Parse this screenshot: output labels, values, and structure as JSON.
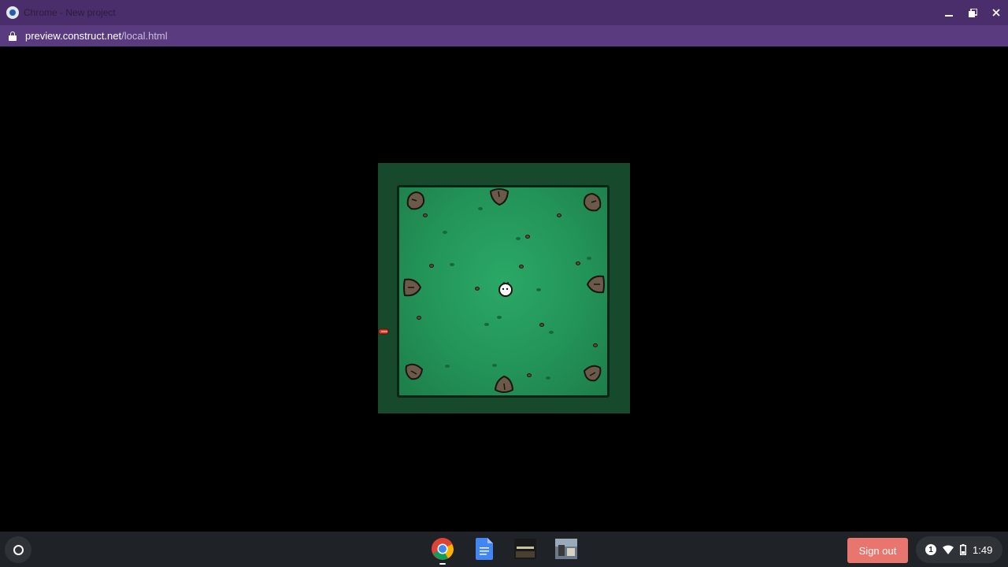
{
  "window": {
    "title": "Chrome - New project",
    "url_host": "preview.construct.net",
    "url_path": "/local.html",
    "controls": {
      "minimize_icon": "minimize-icon",
      "maximize_icon": "restore-icon",
      "close_icon": "close-icon"
    }
  },
  "game": {
    "name": "construct-game-canvas",
    "colors": {
      "floor": "#239458",
      "border": "#174a2d",
      "enemy": "#6b5a4a",
      "player": "#ffffff",
      "arrow": "#d8402a"
    }
  },
  "shelf": {
    "launcher_icon": "launcher-icon",
    "apps": [
      {
        "name": "chrome",
        "icon": "chrome-icon",
        "running": true
      },
      {
        "name": "docs",
        "icon": "docs-icon",
        "running": false
      },
      {
        "name": "app-3",
        "icon": "app-thumbnail-icon",
        "running": false
      },
      {
        "name": "app-4",
        "icon": "app-thumbnail-icon",
        "running": false
      }
    ],
    "signout_label": "Sign out",
    "tray": {
      "notification_count": "1",
      "time": "1:49"
    }
  }
}
